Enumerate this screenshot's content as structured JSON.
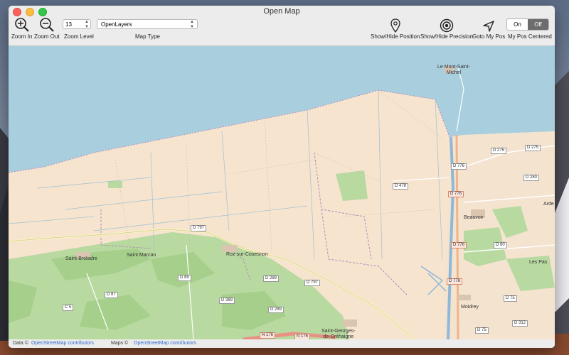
{
  "window": {
    "title": "Open Map"
  },
  "toolbar": {
    "zoom_in": "Zoom In",
    "zoom_out": "Zoom Out",
    "zoom_level_value": "13",
    "zoom_level_label": "Zoom Level",
    "map_type_value": "OpenLayers",
    "map_type_label": "Map Type",
    "show_hide_position": "Show/Hide Position",
    "show_hide_precision": "Show/Hide Precision",
    "goto_my_pos": "Goto My Pos",
    "toggle_on": "On",
    "toggle_off": "Off",
    "toggle_selected": "Off",
    "my_pos_centered": "My Pos Centered"
  },
  "map": {
    "places": {
      "mont_saint_michel": "Le Mont-Saint-Michel",
      "saint_broladre": "Saint-Broladre",
      "saint_marcan": "Saint Marcan",
      "roz_sur_couesnon": "Roz-sur-Couesnon",
      "beauvoir": "Beauvoir",
      "les_pas": "Les Pas",
      "ardevon": "Arde",
      "moidrey": "Moidrey",
      "saint_georges": "Saint-Georges-\nde-Gréhaigne"
    },
    "roads": {
      "d797a": "D 797",
      "d797b": "D 797",
      "d89": "D 89",
      "d87": "D 87",
      "c5": "C 5",
      "d289a": "D 289",
      "d289b": "D 289",
      "d389": "D 389",
      "n176a": "N 176",
      "n176b": "N 176",
      "d478": "D 478",
      "d776a": "D 776",
      "d776b": "D 776",
      "d776c": "D 776",
      "d776d": "D 776",
      "d275a": "D 275",
      "d275b": "D 275",
      "d280": "D 280",
      "d80": "D 80",
      "d75a": "D 75",
      "d75b": "D 75",
      "d312": "D 312"
    }
  },
  "status": {
    "data_label": "Data ©",
    "data_link": "OpenStreetMap contributors",
    "maps_label": "Maps ©",
    "maps_link": "OpenStreetMap contributors"
  }
}
